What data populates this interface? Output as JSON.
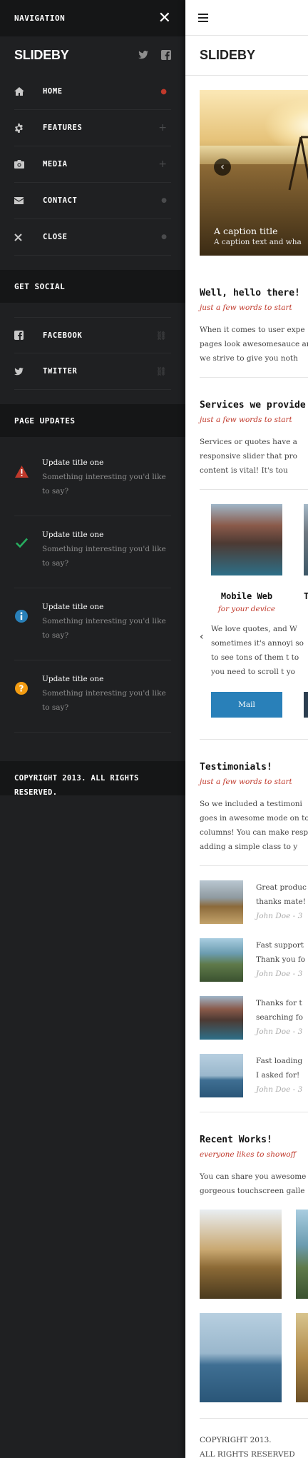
{
  "sidebar": {
    "header_title": "NAVIGATION",
    "close_icon": "close-icon",
    "brand": "SLIDEBY",
    "social_icons": [
      "twitter-icon",
      "facebook-icon"
    ],
    "menu": [
      {
        "label": "HOME",
        "icon": "home-icon",
        "marker": "active-dot"
      },
      {
        "label": "FEATURES",
        "icon": "gear-icon",
        "marker": "plus"
      },
      {
        "label": "MEDIA",
        "icon": "camera-icon",
        "marker": "plus"
      },
      {
        "label": "CONTACT",
        "icon": "mail-icon",
        "marker": "dot"
      },
      {
        "label": "CLOSE",
        "icon": "close-icon",
        "marker": "dot"
      }
    ],
    "social_heading": "GET SOCIAL",
    "social": [
      {
        "label": "FACEBOOK",
        "icon": "facebook-icon"
      },
      {
        "label": "TWITTER",
        "icon": "twitter-icon"
      }
    ],
    "updates_heading": "PAGE UPDATES",
    "updates": [
      {
        "title": "Update title one",
        "text1": "Something interesting you'd like",
        "text2": "to say?",
        "icon": "warning-icon"
      },
      {
        "title": "Update title one",
        "text1": "Something interesting you'd like",
        "text2": "to say?",
        "icon": "check-icon"
      },
      {
        "title": "Update title one",
        "text1": "Something interesting you'd like",
        "text2": "to say?",
        "icon": "info-icon"
      },
      {
        "title": "Update title one",
        "text1": "Something interesting you'd like",
        "text2": "to say?",
        "icon": "help-icon"
      }
    ],
    "copyright_1": "COPYRIGHT 2013. ALL RIGHTS",
    "copyright_2": "RESERVED."
  },
  "main": {
    "title": "SLIDEBY",
    "slider": {
      "caption_title": "A caption title",
      "caption_text": "A caption text and wha"
    },
    "hello": {
      "heading": "Well, hello there!",
      "sub": "just a few words to start",
      "line1": "When it comes to user expe",
      "line2": "pages look awesomesauce an",
      "line3": "we strive to give you noth"
    },
    "services": {
      "heading": "Services we provide",
      "sub": "just a few words to start",
      "line1": "Services or quotes have a",
      "line2": "responsive slider that pro",
      "line3": "content is vital! It's tou",
      "card_title": "Mobile Web",
      "card_title2": "T",
      "card_sub": "for your device",
      "card_line1": "We love quotes, and  W",
      "card_line2": "sometimes it's annoyi so",
      "card_line3": "to see tons of them t to",
      "card_line4": "you need to scroll t yo",
      "btn1": "Mail",
      "btn2": ""
    },
    "testimonials": {
      "heading": "Testimonials!",
      "sub": "just a few words to start",
      "line1": "So we included a testimoni",
      "line2": "goes in awesome mode on to",
      "line3": "columns! You can make resp",
      "line4": "adding a simple class to y",
      "items": [
        {
          "q1": "Great produc",
          "q2": "thanks mate!",
          "who": "John Doe - 3"
        },
        {
          "q1": "Fast support",
          "q2": "Thank you fo",
          "who": "John Doe - 3"
        },
        {
          "q1": "Thanks for t",
          "q2": "searching fo",
          "who": "John Doe - 3"
        },
        {
          "q1": "Fast loading",
          "q2": "I asked for!",
          "who": "John Doe - 3"
        }
      ]
    },
    "works": {
      "heading": "Recent Works!",
      "sub": "everyone likes to showoff",
      "line1": "You can share you awesome",
      "line2": "gorgeous touchscreen galle"
    },
    "footer_1": "COPYRIGHT 2013.",
    "footer_2": "ALL RIGHTS RESERVED"
  },
  "colors": {
    "accent_red": "#c0392b",
    "button_blue": "#2980b9",
    "sidebar_bg": "#1f2022"
  }
}
